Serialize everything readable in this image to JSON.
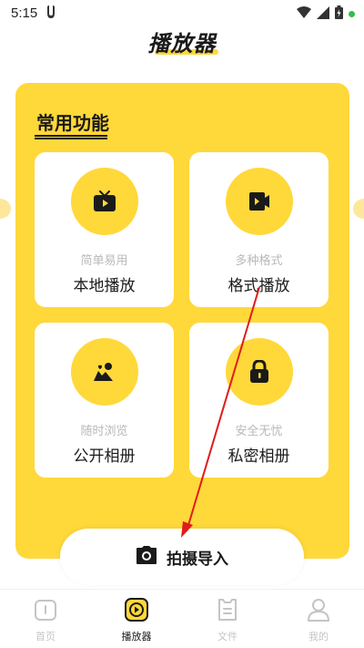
{
  "status_bar": {
    "time": "5:15"
  },
  "header": {
    "title": "播放器"
  },
  "section": {
    "title": "常用功能"
  },
  "cards": [
    {
      "subtitle": "简单易用",
      "label": "本地播放",
      "icon": "tv-icon"
    },
    {
      "subtitle": "多种格式",
      "label": "格式播放",
      "icon": "video-file-icon"
    },
    {
      "subtitle": "随时浏览",
      "label": "公开相册",
      "icon": "photo-album-icon"
    },
    {
      "subtitle": "安全无忧",
      "label": "私密相册",
      "icon": "lock-icon"
    }
  ],
  "import_button": {
    "label": "拍摄导入",
    "icon": "camera-icon"
  },
  "bottom_nav": {
    "items": [
      {
        "label": "首页",
        "icon": "home-icon",
        "active": false
      },
      {
        "label": "播放器",
        "icon": "player-icon",
        "active": true
      },
      {
        "label": "文件",
        "icon": "file-icon",
        "active": false
      },
      {
        "label": "我的",
        "icon": "profile-icon",
        "active": false
      }
    ]
  },
  "colors": {
    "accent": "#ffd83a",
    "text": "#1a1a1a",
    "muted": "#b9b9b9",
    "annotation": "#e01b1b"
  }
}
